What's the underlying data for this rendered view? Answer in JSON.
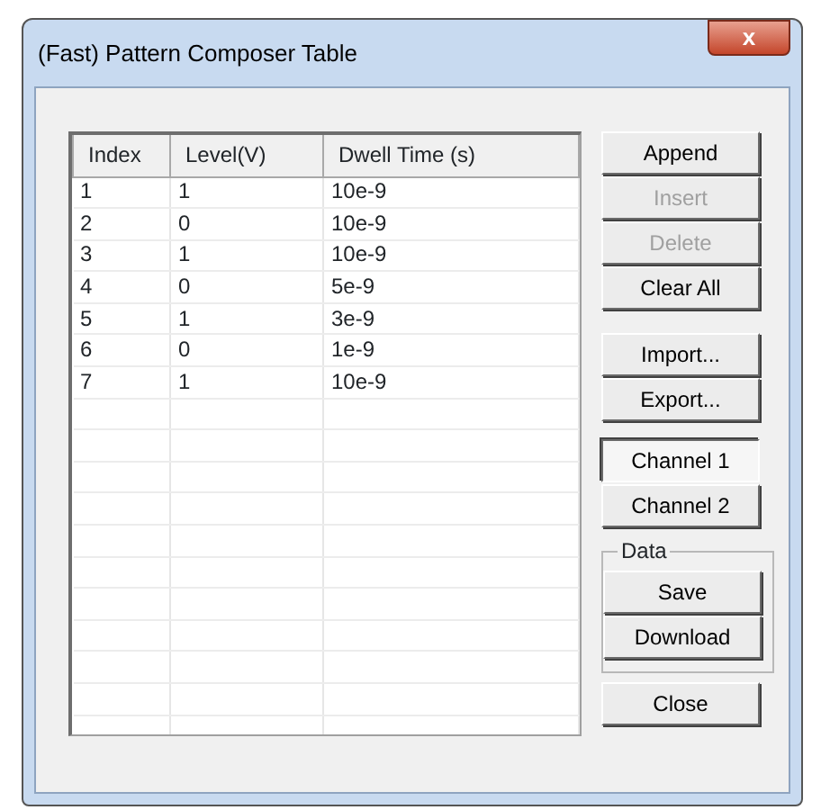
{
  "window": {
    "title": "(Fast) Pattern Composer Table",
    "close_glyph": "x"
  },
  "table": {
    "columns": [
      "Index",
      "Level(V)",
      "Dwell Time (s)"
    ],
    "rows": [
      [
        "1",
        "1",
        "10e-9"
      ],
      [
        "2",
        "0",
        "10e-9"
      ],
      [
        "3",
        "1",
        "10e-9"
      ],
      [
        "4",
        "0",
        "5e-9"
      ],
      [
        "5",
        "1",
        "3e-9"
      ],
      [
        "6",
        "0",
        "1e-9"
      ],
      [
        "7",
        "1",
        "10e-9"
      ]
    ]
  },
  "buttons": [
    {
      "label": "Append",
      "disabled": false
    },
    {
      "label": "Insert",
      "disabled": true
    },
    {
      "label": "Delete",
      "disabled": true
    },
    {
      "label": "Clear All",
      "disabled": false
    },
    {
      "label": "Import...",
      "disabled": false
    },
    {
      "label": "Export...",
      "disabled": false
    }
  ],
  "channels": [
    {
      "label": "Channel 1",
      "selected": true
    },
    {
      "label": "Channel 2",
      "selected": false
    }
  ],
  "data_group": {
    "title": "Data",
    "buttons": [
      {
        "label": "Save"
      },
      {
        "label": "Download"
      }
    ]
  },
  "close_button": {
    "label": "Close"
  }
}
